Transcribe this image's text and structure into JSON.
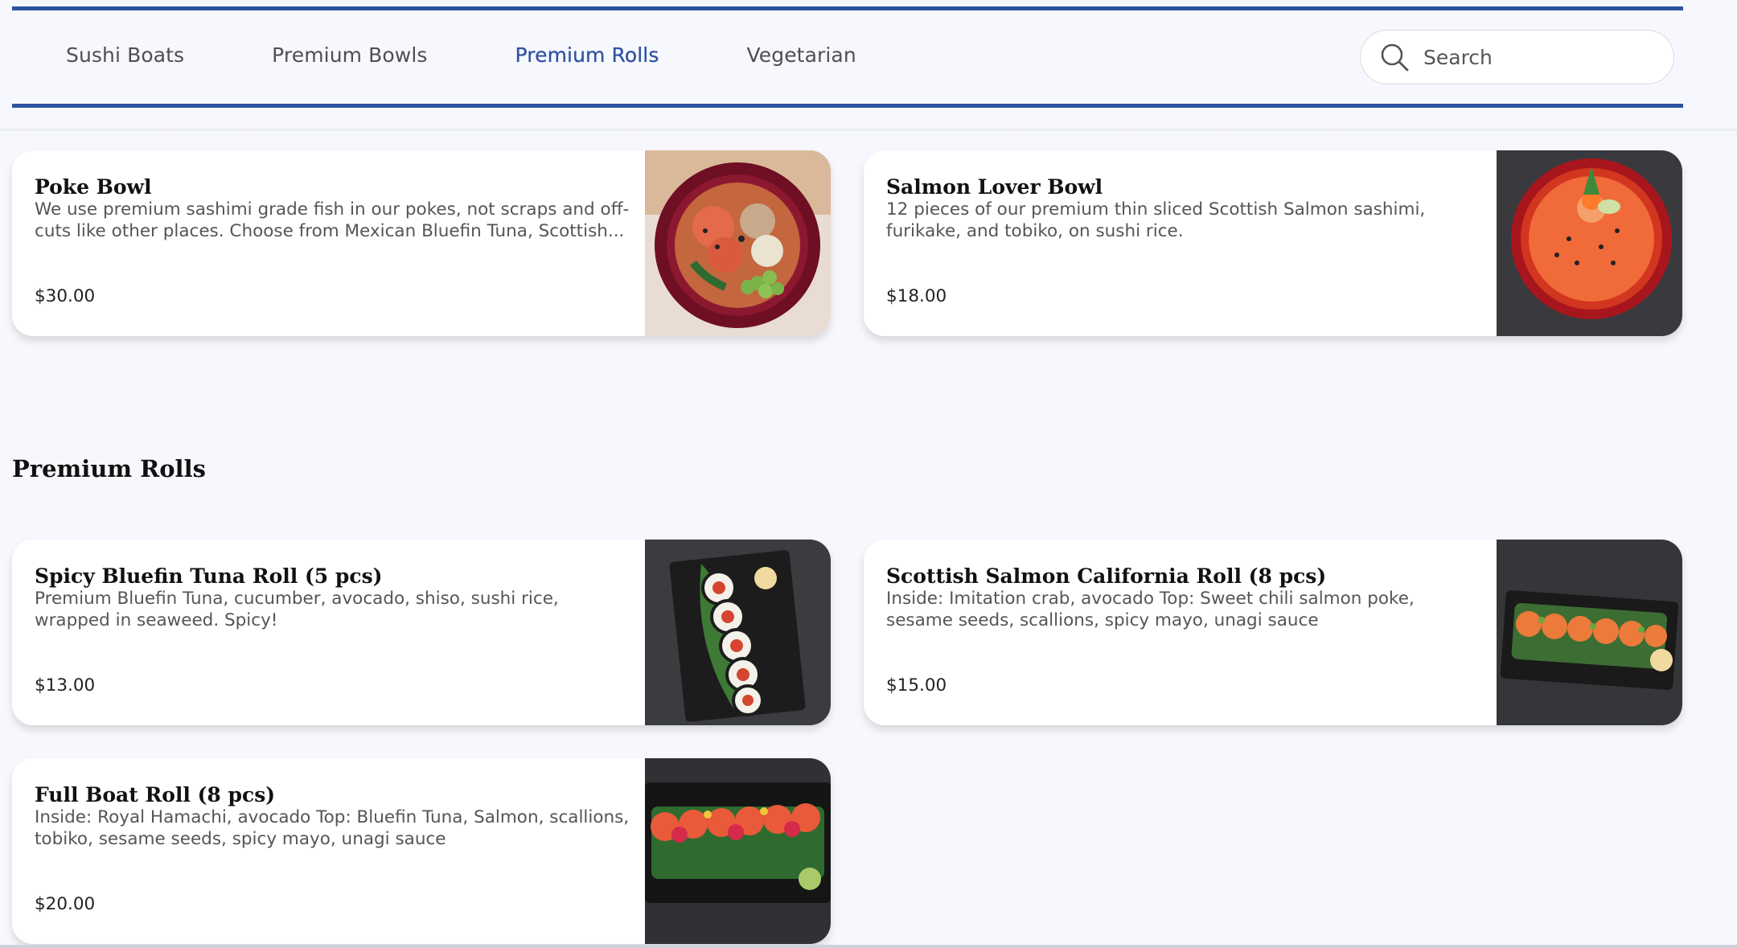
{
  "nav": {
    "tabs": [
      {
        "label": "Sushi Boats",
        "active": false
      },
      {
        "label": "Premium Bowls",
        "active": false
      },
      {
        "label": "Premium Rolls",
        "active": true
      },
      {
        "label": "Vegetarian",
        "active": false
      }
    ],
    "search": {
      "placeholder": "Search",
      "icon": "search-icon"
    }
  },
  "bowls": [
    {
      "title": "Poke Bowl",
      "description": "We use premium sashimi grade fish in our pokes, not scraps and off-cuts like other places. Choose from Mexican Bluefin Tuna, Scottish...",
      "price": "$30.00",
      "image": "poke-bowl-photo"
    },
    {
      "title": "Salmon Lover Bowl",
      "description": "12 pieces of our premium thin sliced Scottish Salmon sashimi, furikake, and tobiko, on sushi rice.",
      "price": "$18.00",
      "image": "salmon-bowl-photo"
    }
  ],
  "rolls_section": {
    "title": "Premium Rolls",
    "items": [
      {
        "title": "Spicy Bluefin Tuna Roll (5 pcs)",
        "description": "Premium Bluefin Tuna, cucumber, avocado, shiso, sushi rice, wrapped in seaweed. Spicy!",
        "price": "$13.00",
        "image": "tuna-roll-photo"
      },
      {
        "title": "Scottish Salmon California Roll (8 pcs)",
        "description": "Inside: Imitation crab, avocado Top: Sweet chili salmon poke, sesame seeds, scallions, spicy mayo, unagi sauce",
        "price": "$15.00",
        "image": "salmon-california-roll-photo"
      },
      {
        "title": "Full Boat Roll (8 pcs)",
        "description": "Inside: Royal Hamachi, avocado Top: Bluefin Tuna, Salmon, scallions, tobiko, sesame seeds, spicy mayo, unagi sauce",
        "price": "$20.00",
        "image": "full-boat-roll-photo"
      }
    ]
  },
  "colors": {
    "accent": "#2f52a0",
    "background": "#f7f8fd",
    "card": "#ffffff"
  }
}
